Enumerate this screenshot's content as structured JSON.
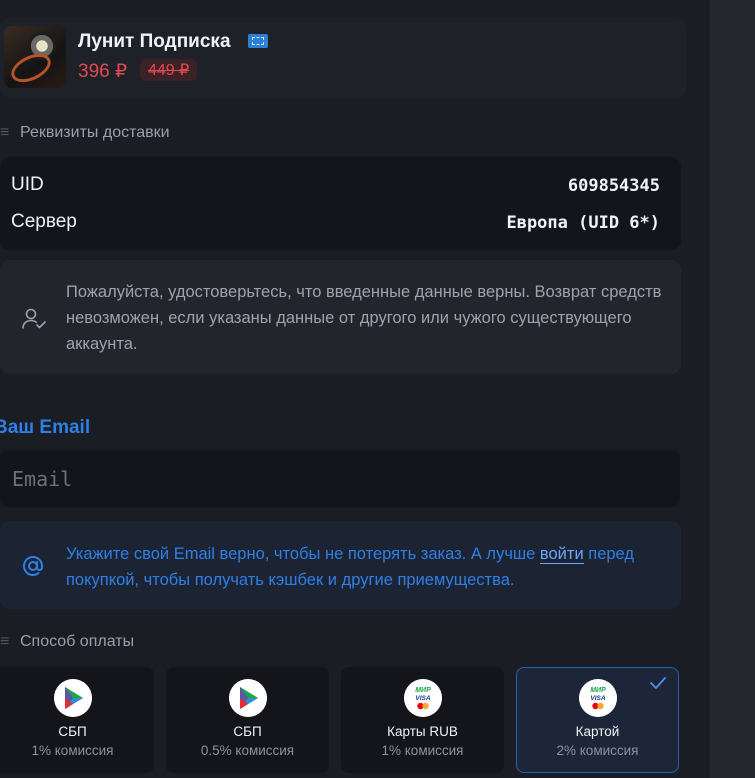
{
  "product": {
    "title": "Лунит Подписка",
    "price": "396 ₽",
    "old_price": "449 ₽"
  },
  "delivery": {
    "section_label": "Реквизиты доставки",
    "rows": [
      {
        "label": "UID",
        "value": "609854345"
      },
      {
        "label": "Сервер",
        "value": "Европа (UID 6*)"
      }
    ]
  },
  "warning": {
    "icon": "user-check-icon",
    "text": "Пожалуйста, удостоверьтесь, что введенные данные верны. Возврат средств невозможен, если указаны данные от другого или чужого существующего аккаунта."
  },
  "email": {
    "label": "Ваш Email",
    "placeholder": "Email",
    "value": ""
  },
  "email_info": {
    "icon": "at-icon",
    "text_before": "Укажите свой Email верно, чтобы не потерять заказ. А лучше ",
    "link": "войти",
    "text_after": " перед покупкой, чтобы получать кэшбек и другие приемущества."
  },
  "payment": {
    "section_label": "Способ оплаты",
    "methods": [
      {
        "name": "СБП",
        "fee": "1% комиссия",
        "icon": "sbp-logo-icon",
        "selected": false
      },
      {
        "name": "СБП",
        "fee": "0.5% комиссия",
        "icon": "sbp-logo-icon",
        "selected": false
      },
      {
        "name": "Карты RUB",
        "fee": "1% комиссия",
        "icon": "mir-visa-mastercard-icon",
        "selected": false
      },
      {
        "name": "Картой",
        "fee": "2% комиссия",
        "icon": "mir-visa-mastercard-icon",
        "selected": true
      }
    ]
  },
  "colors": {
    "accent": "#2f7fe6",
    "price": "#e0494f",
    "background": "#1a1d23",
    "selected_card": "#1c2638"
  }
}
